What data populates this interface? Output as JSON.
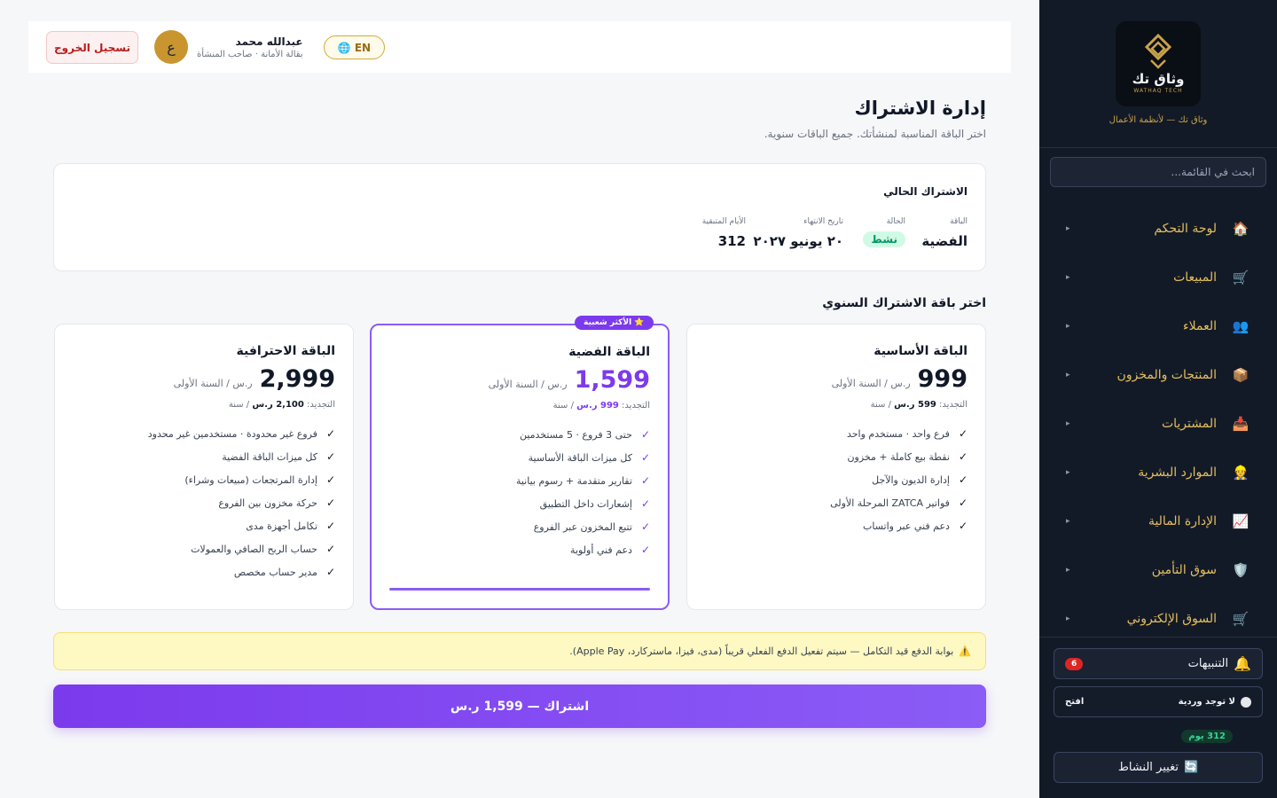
{
  "sidebar": {
    "brand_name": "وثاق تك",
    "brand_sub": "WATHAQ TECH",
    "brand_tagline": "وثاق تك — لأنظمة الأعمال",
    "search_placeholder": "ابحث في القائمة...",
    "nav": [
      {
        "label": "لوحة التحكم",
        "icon": "🏠"
      },
      {
        "label": "المبيعات",
        "icon": "🛒"
      },
      {
        "label": "العملاء",
        "icon": "👥"
      },
      {
        "label": "المنتجات والمخزون",
        "icon": "📦"
      },
      {
        "label": "المشتريات",
        "icon": "📥"
      },
      {
        "label": "الموارد البشرية",
        "icon": "👷"
      },
      {
        "label": "الإدارة المالية",
        "icon": "📈"
      },
      {
        "label": "سوق التأمين",
        "icon": "🛡️"
      },
      {
        "label": "السوق الإلكتروني",
        "icon": "🛒"
      }
    ],
    "arrow": "▸",
    "notifications_label": "التنبيهات",
    "notifications_icon": "🔔",
    "notifications_count": "6",
    "shift_label": "لا توجد وردية",
    "shift_open": "افتح",
    "days_badge": "312 يوم",
    "switch_label": "تغيير النشاط",
    "switch_icon": "🔄"
  },
  "topbar": {
    "logout": "تسجيل الخروج",
    "user_name": "عبدالله محمد",
    "user_role": "بقالة الأمانة · صاحب المنشأة",
    "avatar_letter": "ع",
    "lang": "EN",
    "lang_icon": "🌐"
  },
  "page": {
    "title": "إدارة الاشتراك",
    "subtitle": "اختر الباقة المناسبة لمنشأتك. جميع الباقات سنوية."
  },
  "current": {
    "title": "الاشتراك الحالي",
    "plan_label": "الباقة",
    "plan_value": "الفضية",
    "status_label": "الحالة",
    "status_value": "نشط",
    "expiry_label": "تاريخ الانتهاء",
    "expiry_value": "٢٠ يونيو ٢٠٢٧",
    "days_label": "الأيام المتبقية",
    "days_value": "312"
  },
  "plans_title": "اختر باقة الاشتراك السنوي",
  "plans": [
    {
      "name": "الباقة الأساسية",
      "price": "999",
      "unit": "ر.س / السنة الأولى",
      "renew_label": "التجديد:",
      "renew_value": "599 ر.س",
      "renew_suffix": "/ سنة",
      "features": [
        "فرع واحد · مستخدم واحد",
        "نقطة بيع كاملة + مخزون",
        "إدارة الديون والآجل",
        "فواتير ZATCA المرحلة الأولى",
        "دعم فني عبر واتساب"
      ]
    },
    {
      "name": "الباقة الفضية",
      "price": "1,599",
      "unit": "ر.س / السنة الأولى",
      "renew_label": "التجديد:",
      "renew_value": "999 ر.س",
      "renew_suffix": "/ سنة",
      "badge": "⭐ الأكثر شعبية",
      "features": [
        "حتى 3 فروع · 5 مستخدمين",
        "كل ميزات الباقة الأساسية",
        "تقارير متقدمة + رسوم بيانية",
        "إشعارات داخل التطبيق",
        "تتبع المخزون عبر الفروع",
        "دعم فني أولوية"
      ]
    },
    {
      "name": "الباقة الاحترافية",
      "price": "2,999",
      "unit": "ر.س / السنة الأولى",
      "renew_label": "التجديد:",
      "renew_value": "2,100 ر.س",
      "renew_suffix": "/ سنة",
      "features": [
        "فروع غير محدودة · مستخدمين غير محدود",
        "كل ميزات الباقة الفضية",
        "إدارة المرتجعات (مبيعات وشراء)",
        "حركة مخزون بين الفروع",
        "تكامل أجهزة مدى",
        "حساب الربح الصافي والعمولات",
        "مدير حساب مخصص"
      ]
    }
  ],
  "check_mark": "✓",
  "notice": {
    "icon": "⚠️",
    "text": "بوابة الدفع قيد التكامل — سيتم تفعيل الدفع الفعلي قريباً (مدى، فيزا، ماستركارد، Apple Pay)."
  },
  "subscribe_button": "اشتراك — 1,599 ر.س",
  "colors": {
    "accent": "#7c3aed",
    "sidebar_bg": "#131a27",
    "gold": "#e3bf5f",
    "success": "#059669",
    "danger": "#dc2626"
  }
}
